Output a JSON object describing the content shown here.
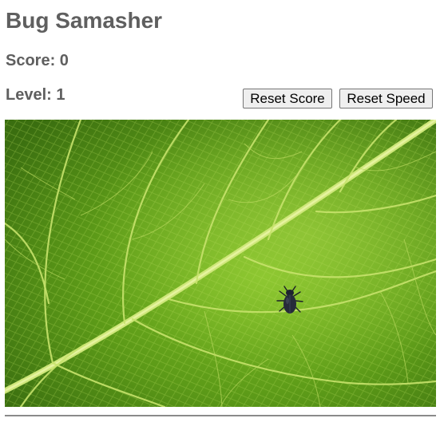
{
  "game": {
    "title": "Bug Samasher"
  },
  "stats": {
    "score_text": "Score: 0",
    "level_text": "Level: 1",
    "score": 0,
    "level": 1
  },
  "controls": {
    "reset_score_label": "Reset Score",
    "reset_speed_label": "Reset Speed"
  },
  "playfield": {
    "background": "green-leaf-macro",
    "colors": {
      "leaf_dark": "#3f7a12",
      "leaf_mid": "#6aa81e",
      "leaf_light": "#9ccc3a",
      "vein": "#c8e36a",
      "bug": "#1e2230"
    }
  },
  "bug": {
    "icon": "beetle-icon"
  }
}
